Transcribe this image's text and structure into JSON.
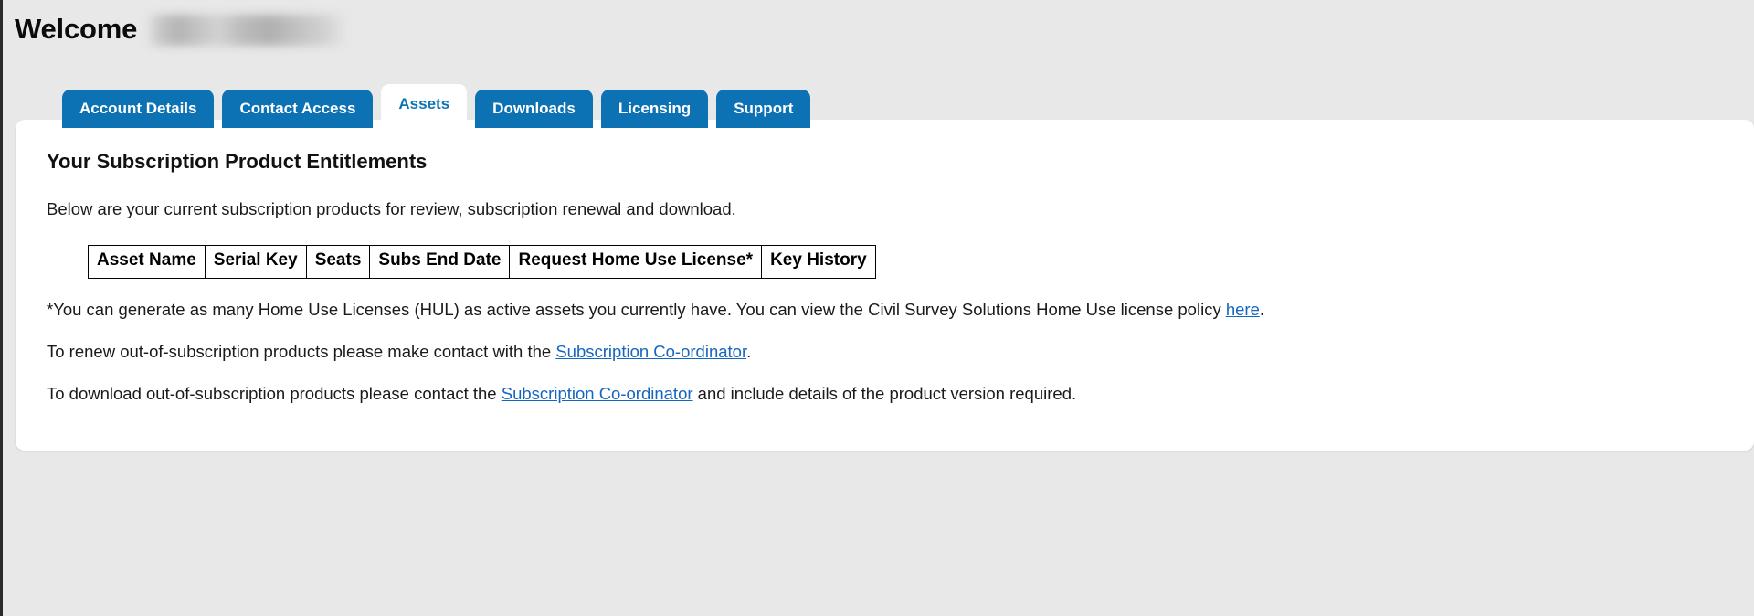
{
  "header": {
    "welcome_label": "Welcome",
    "account_name_redacted": ""
  },
  "tabs": [
    {
      "id": "account-details",
      "label": "Account Details",
      "active": false
    },
    {
      "id": "contact-access",
      "label": "Contact Access",
      "active": false
    },
    {
      "id": "assets",
      "label": "Assets",
      "active": true
    },
    {
      "id": "downloads",
      "label": "Downloads",
      "active": false
    },
    {
      "id": "licensing",
      "label": "Licensing",
      "active": false
    },
    {
      "id": "support",
      "label": "Support",
      "active": false
    }
  ],
  "main": {
    "section_title": "Your Subscription Product Entitlements",
    "intro": "Below are your current subscription products for review, subscription renewal and download.",
    "table": {
      "columns": [
        "Asset Name",
        "Serial Key",
        "Seats",
        "Subs End Date",
        "Request Home Use License*",
        "Key History"
      ],
      "rows": []
    },
    "footnote": {
      "part1": "*You can generate as many Home Use Licenses (HUL) as active assets you currently have. You can view the Civil Survey Solutions Home Use license policy ",
      "link": "here",
      "part2": "."
    },
    "renew_note": {
      "part1": "To renew out-of-subscription products please make contact with the ",
      "link": "Subscription Co-ordinator",
      "part2": "."
    },
    "download_note": {
      "part1": "To download out-of-subscription products please contact the ",
      "link": "Subscription Co-ordinator",
      "part2": " and include details of the product version required."
    }
  },
  "colors": {
    "tab_blue": "#0c72b4",
    "active_tab_text": "#0c72b4",
    "link_blue": "#1566c0",
    "page_background": "#e8e8e8",
    "panel_background": "#ffffff"
  }
}
